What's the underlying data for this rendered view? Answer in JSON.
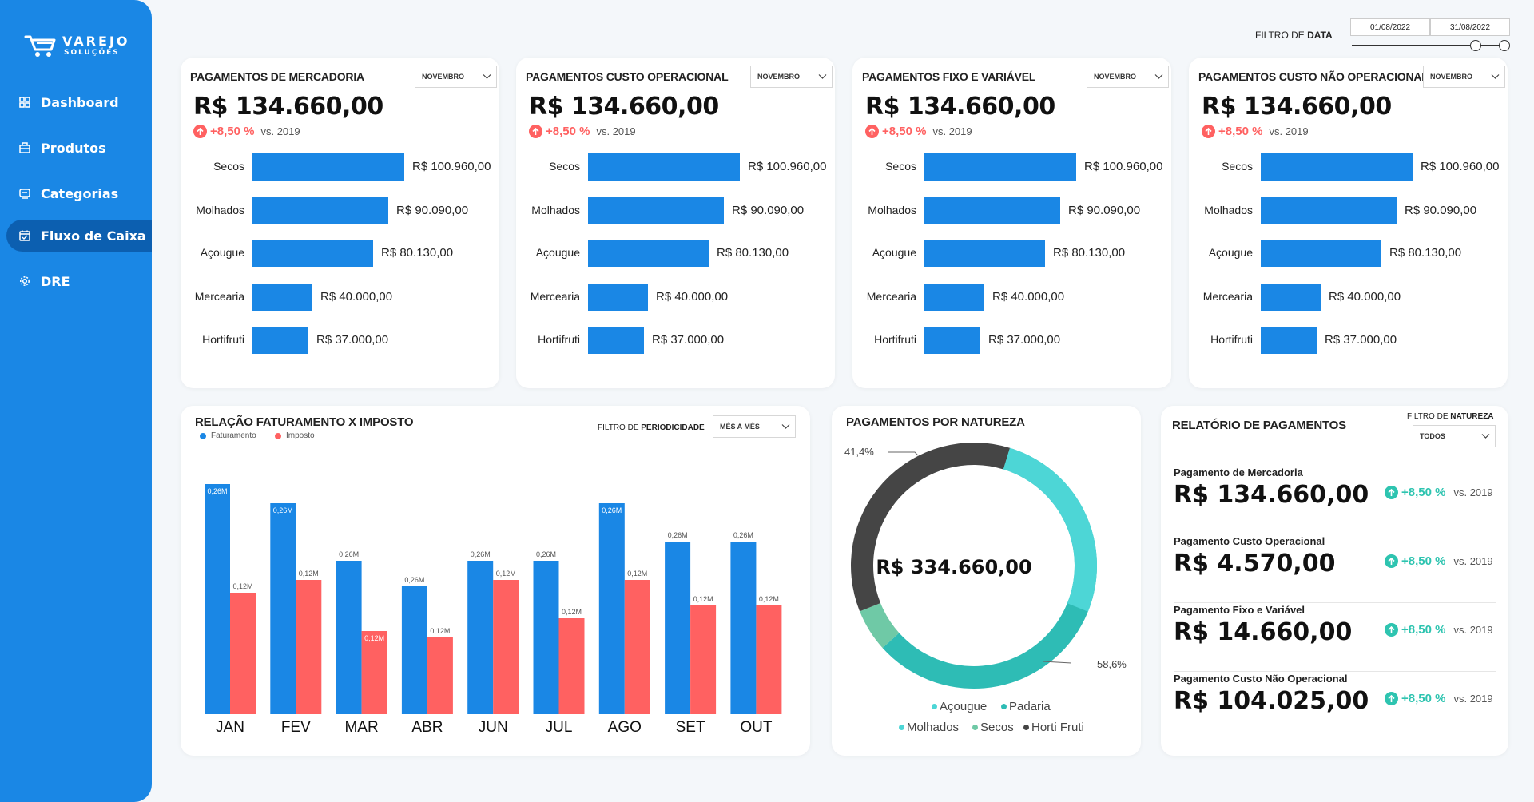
{
  "brand": {
    "line1": "VAREJO",
    "line2": "SOLUÇÕES"
  },
  "nav": [
    {
      "label": "Dashboard",
      "icon": "grid-icon"
    },
    {
      "label": "Produtos",
      "icon": "box-icon"
    },
    {
      "label": "Categorias",
      "icon": "tag-icon"
    },
    {
      "label": "Fluxo de Caixa",
      "icon": "calendar-icon",
      "active": true
    },
    {
      "label": "DRE",
      "icon": "gear-icon"
    }
  ],
  "date_filter": {
    "label_prefix": "FILTRO DE",
    "label_bold": "DATA",
    "start": "01/08/2022",
    "end": "31/08/2022"
  },
  "payment_cards": [
    {
      "title": "PAGAMENTOS DE MERCADORIA",
      "dropdown": "NOVEMBRO",
      "value": "R$ 134.660,00",
      "trend": "+8,50 %",
      "vs": "vs. 2019",
      "bars": [
        {
          "label": "Secos",
          "amount": 100960,
          "value_label": "R$ 100.960,00"
        },
        {
          "label": "Molhados",
          "amount": 90090,
          "value_label": "R$ 90.090,00"
        },
        {
          "label": "Açougue",
          "amount": 80130,
          "value_label": "R$ 80.130,00"
        },
        {
          "label": "Mercearia",
          "amount": 40000,
          "value_label": "R$ 40.000,00"
        },
        {
          "label": "Hortifruti",
          "amount": 37000,
          "value_label": "R$ 37.000,00"
        }
      ]
    },
    {
      "title": "PAGAMENTOS CUSTO OPERACIONAL",
      "dropdown": "NOVEMBRO",
      "value": "R$ 134.660,00",
      "trend": "+8,50 %",
      "vs": "vs. 2019",
      "bars": [
        {
          "label": "Secos",
          "amount": 100960,
          "value_label": "R$ 100.960,00"
        },
        {
          "label": "Molhados",
          "amount": 90090,
          "value_label": "R$ 90.090,00"
        },
        {
          "label": "Açougue",
          "amount": 80130,
          "value_label": "R$ 80.130,00"
        },
        {
          "label": "Mercearia",
          "amount": 40000,
          "value_label": "R$ 40.000,00"
        },
        {
          "label": "Hortifruti",
          "amount": 37000,
          "value_label": "R$ 37.000,00"
        }
      ]
    },
    {
      "title": "PAGAMENTOS FIXO E VARIÁVEL",
      "dropdown": "NOVEMBRO",
      "value": "R$ 134.660,00",
      "trend": "+8,50 %",
      "vs": "vs. 2019",
      "bars": [
        {
          "label": "Secos",
          "amount": 100960,
          "value_label": "R$ 100.960,00"
        },
        {
          "label": "Molhados",
          "amount": 90090,
          "value_label": "R$ 90.090,00"
        },
        {
          "label": "Açougue",
          "amount": 80130,
          "value_label": "R$ 80.130,00"
        },
        {
          "label": "Mercearia",
          "amount": 40000,
          "value_label": "R$ 40.000,00"
        },
        {
          "label": "Hortifruti",
          "amount": 37000,
          "value_label": "R$ 37.000,00"
        }
      ]
    },
    {
      "title": "PAGAMENTOS CUSTO NÃO OPERACIONAL",
      "dropdown": "NOVEMBRO",
      "value": "R$ 134.660,00",
      "trend": "+8,50 %",
      "vs": "vs. 2019",
      "bars": [
        {
          "label": "Secos",
          "amount": 100960,
          "value_label": "R$ 100.960,00"
        },
        {
          "label": "Molhados",
          "amount": 90090,
          "value_label": "R$ 90.090,00"
        },
        {
          "label": "Açougue",
          "amount": 80130,
          "value_label": "R$ 80.130,00"
        },
        {
          "label": "Mercearia",
          "amount": 40000,
          "value_label": "R$ 40.000,00"
        },
        {
          "label": "Hortifruti",
          "amount": 37000,
          "value_label": "R$ 37.000,00"
        }
      ]
    }
  ],
  "revenue_chart": {
    "title": "RELAÇÃO FATURAMENTO X IMPOSTO",
    "filter_prefix": "FILTRO DE",
    "filter_bold": "PERIODICIDADE",
    "dropdown": "MÊS A MÊS"
  },
  "nature_chart": {
    "title": "PAGAMENTOS POR NATUREZA",
    "center_value": "R$ 334.660,00"
  },
  "report": {
    "title": "RELATÓRIO DE PAGAMENTOS",
    "filter_prefix": "FILTRO DE",
    "filter_bold": "NATUREZA",
    "dropdown": "TODOS",
    "items": [
      {
        "title": "Pagamento de Mercadoria",
        "value": "R$ 134.660,00",
        "trend": "+8,50 %",
        "vs": "vs. 2019"
      },
      {
        "title": "Pagamento Custo Operacional",
        "value": "R$ 4.570,00",
        "trend": "+8,50 %",
        "vs": "vs. 2019"
      },
      {
        "title": "Pagamento Fixo e Variável",
        "value": "R$ 14.660,00",
        "trend": "+8,50 %",
        "vs": "vs. 2019"
      },
      {
        "title": "Pagamento Custo Não Operacional",
        "value": "R$ 104.025,00",
        "trend": "+8,50 %",
        "vs": "vs. 2019"
      }
    ]
  },
  "colors": {
    "primary": "#1a87e5",
    "red": "#ff6161",
    "teal": "#2ec4b0",
    "dark": "#454545",
    "aqua": "#4dd6d6",
    "mint": "#6fc9a6"
  },
  "chart_data": [
    {
      "type": "bar",
      "title": "RELAÇÃO FATURAMENTO X IMPOSTO",
      "categories": [
        "JAN",
        "FEV",
        "MAR",
        "ABR",
        "JUN",
        "JUL",
        "AGO",
        "SET",
        "OUT"
      ],
      "series": [
        {
          "name": "Faturamento",
          "color": "#1a87e5",
          "values": [
            0.36,
            0.33,
            0.24,
            0.2,
            0.24,
            0.24,
            0.33,
            0.27,
            0.27
          ],
          "labels": [
            "0,26M",
            "0,26M",
            "0,26M",
            "0,26M",
            "0,26M",
            "0,26M",
            "0,26M",
            "0,26M",
            "0,26M"
          ]
        },
        {
          "name": "Imposto",
          "color": "#ff6161",
          "values": [
            0.19,
            0.21,
            0.13,
            0.12,
            0.21,
            0.15,
            0.21,
            0.17,
            0.17
          ],
          "labels": [
            "0,12M",
            "0,12M",
            "0,12M",
            "0,12M",
            "0,12M",
            "0,12M",
            "0,12M",
            "0,12M",
            "0,12M"
          ]
        }
      ],
      "legend": "top-left",
      "grid": false
    },
    {
      "type": "pie",
      "title": "PAGAMENTOS POR NATUREZA",
      "slices": [
        {
          "name": "Padaria",
          "value": 58.6,
          "color": "#2ebcb5"
        },
        {
          "name": "Secos",
          "value": 5.6,
          "color": "#6fc9a6"
        },
        {
          "name": "Horti Fruti",
          "value": 35.8,
          "color": "#454545"
        }
      ],
      "legend_items": [
        {
          "name": "Açougue",
          "color": "#4dd6d6"
        },
        {
          "name": "Padaria",
          "color": "#2ebcb5"
        },
        {
          "name": "Molhados",
          "color": "#4dd6d6"
        },
        {
          "name": "Secos",
          "color": "#6fc9a6"
        },
        {
          "name": "Horti Fruti",
          "color": "#454545"
        }
      ],
      "annotations": [
        "41,4%",
        "58,6%"
      ],
      "legend": "bottom"
    }
  ]
}
